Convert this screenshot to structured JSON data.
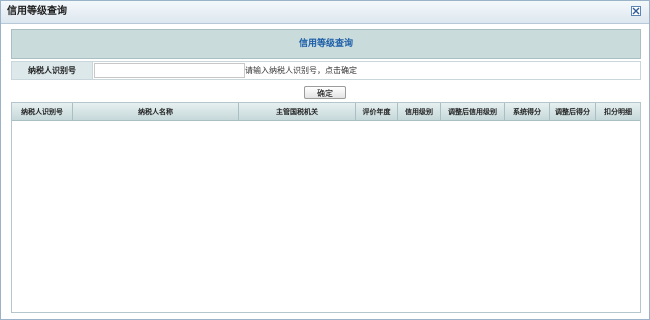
{
  "window": {
    "title": "信用等级查询"
  },
  "panel": {
    "heading": "信用等级查询"
  },
  "search": {
    "label": "纳税人识别号",
    "value": "",
    "hint": "请输入纳税人识别号，点击确定"
  },
  "actions": {
    "confirm_label": "确定"
  },
  "table": {
    "columns": [
      "纳税人识别号",
      "纳税人名称",
      "主管国税机关",
      "评价年度",
      "信用级别",
      "调整后信用级别",
      "系统得分",
      "调整后得分",
      "扣分明细"
    ],
    "rows": []
  },
  "colors": {
    "header_bg": "#c9dbdb",
    "heading_text": "#1e5fa8",
    "border": "#a9bfc2"
  }
}
